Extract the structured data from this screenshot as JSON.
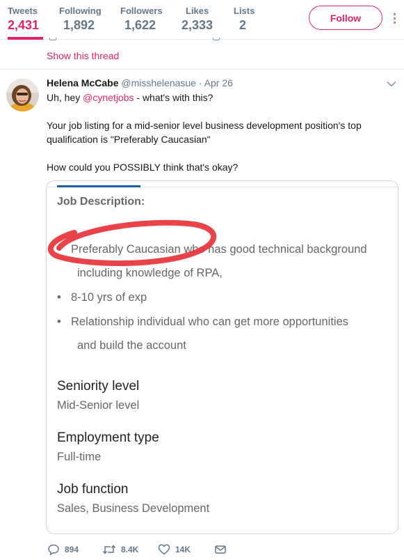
{
  "nav": {
    "stats": [
      {
        "label": "Tweets",
        "value": "2,431"
      },
      {
        "label": "Following",
        "value": "1,892"
      },
      {
        "label": "Followers",
        "value": "1,622"
      },
      {
        "label": "Likes",
        "value": "2,333"
      },
      {
        "label": "Lists",
        "value": "2"
      }
    ],
    "follow_label": "Follow"
  },
  "thread": {
    "show_label": "Show this thread"
  },
  "tweet": {
    "name": "Helena McCabe",
    "handle": "@misshelenasue",
    "separator": "·",
    "date": "Apr 26",
    "line1_pre": "Uh, hey ",
    "line1_mention": "@cynetjobs",
    "line1_post": " - what's with this?",
    "para2": "Your job listing for a mid-senior level business development position's top qualification is \"Preferably Caucasian\"",
    "para3": "How could you POSSIBLY think that's okay?"
  },
  "media": {
    "heading": "Job Description:",
    "bullets": [
      {
        "line1": "Preferably Caucasian who has good technical background",
        "line2": "including knowledge of RPA,"
      },
      {
        "line1": "8-10 yrs of exp",
        "line2": ""
      },
      {
        "line1": "Relationship individual who can get more opportunities",
        "line2": "and build the account"
      }
    ],
    "sections": [
      {
        "title": "Seniority level",
        "value": "Mid-Senior level"
      },
      {
        "title": "Employment type",
        "value": "Full-time"
      },
      {
        "title": "Job function",
        "value": "Sales, Business Development"
      }
    ],
    "bullet_char": "•"
  },
  "actions": {
    "reply_count": "894",
    "retweet_count": "8.4K",
    "like_count": "14K"
  },
  "colors": {
    "accent": "#e0246a",
    "muted": "#657786",
    "annotation_red": "#e8383e"
  }
}
